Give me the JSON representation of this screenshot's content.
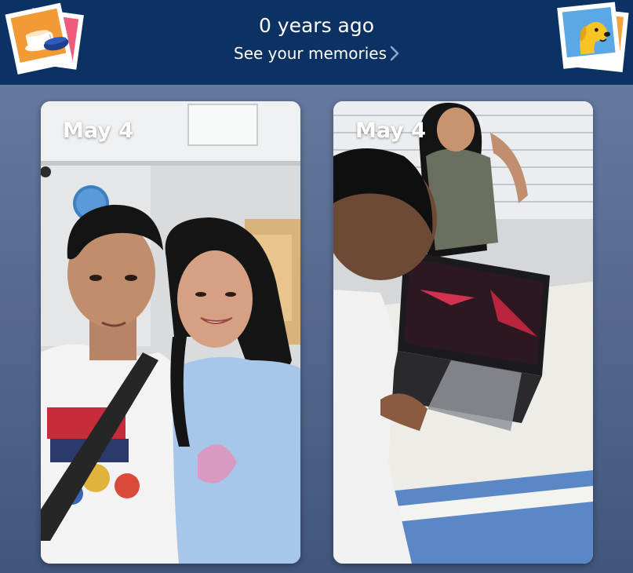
{
  "header": {
    "title": "0 years ago",
    "link_label": "See your memories",
    "link_icon": "chevron-right-icon",
    "left_sticker_icon": "coffee-cup-photo-icon",
    "right_sticker_icon": "dog-photo-icon",
    "background_color": "#0c3163"
  },
  "memories": [
    {
      "date": "May 4"
    },
    {
      "date": "May 4"
    }
  ]
}
